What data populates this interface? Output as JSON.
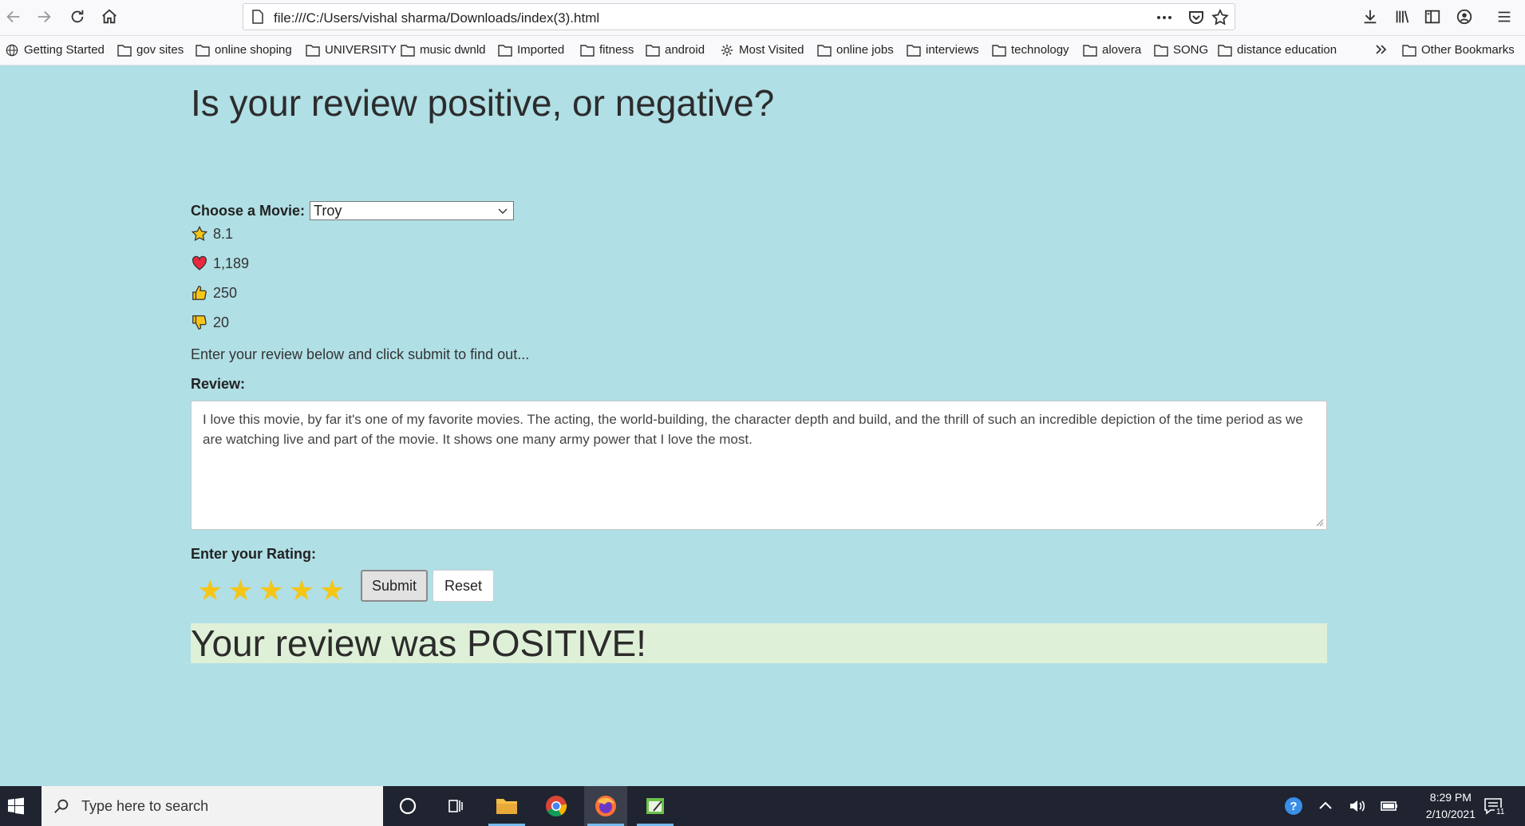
{
  "browser": {
    "url": "file:///C:/Users/vishal sharma/Downloads/index(3).html",
    "bookmarks": [
      {
        "label": "Getting Started",
        "icon": "globe-icon"
      },
      {
        "label": "gov sites",
        "icon": "folder-icon"
      },
      {
        "label": "online shoping",
        "icon": "folder-icon"
      },
      {
        "label": "UNIVERSITY",
        "icon": "folder-icon"
      },
      {
        "label": "music dwnld",
        "icon": "folder-icon"
      },
      {
        "label": "Imported",
        "icon": "folder-icon"
      },
      {
        "label": "fitness",
        "icon": "folder-icon"
      },
      {
        "label": "android",
        "icon": "folder-icon"
      },
      {
        "label": "Most Visited",
        "icon": "gear-icon"
      },
      {
        "label": "online jobs",
        "icon": "folder-icon"
      },
      {
        "label": "interviews",
        "icon": "folder-icon"
      },
      {
        "label": "technology",
        "icon": "folder-icon"
      },
      {
        "label": "alovera",
        "icon": "folder-icon"
      },
      {
        "label": "SONG",
        "icon": "folder-icon"
      },
      {
        "label": "distance education",
        "icon": "folder-icon"
      }
    ],
    "other_bookmarks": "Other Bookmarks"
  },
  "page": {
    "title": "Is your review positive, or negative?",
    "movie_label": "Choose a Movie:",
    "movie_selected": "Troy",
    "stats": {
      "rating": "8.1",
      "likes": "1,189",
      "thumbs_up": "250",
      "thumbs_down": "20"
    },
    "intro": "Enter your review below and click submit to find out...",
    "review_label": "Review:",
    "review_text": "I love this movie, by far it's one of my favorite movies. The acting, the world-building, the character depth and build, and the thrill of such an incredible depiction of the time period as we are watching live and part of the movie. It shows one many army power that I love the most.",
    "rating_label": "Enter your Rating:",
    "rating_value": 5,
    "rating_max": 5,
    "submit_label": "Submit",
    "reset_label": "Reset",
    "result": "Your review was POSITIVE!",
    "star_color": "#f5c518",
    "result_bg": "#dff0d8"
  },
  "taskbar": {
    "search_placeholder": "Type here to search",
    "time": "8:29 PM",
    "date": "2/10/2021",
    "notifications": "11"
  }
}
